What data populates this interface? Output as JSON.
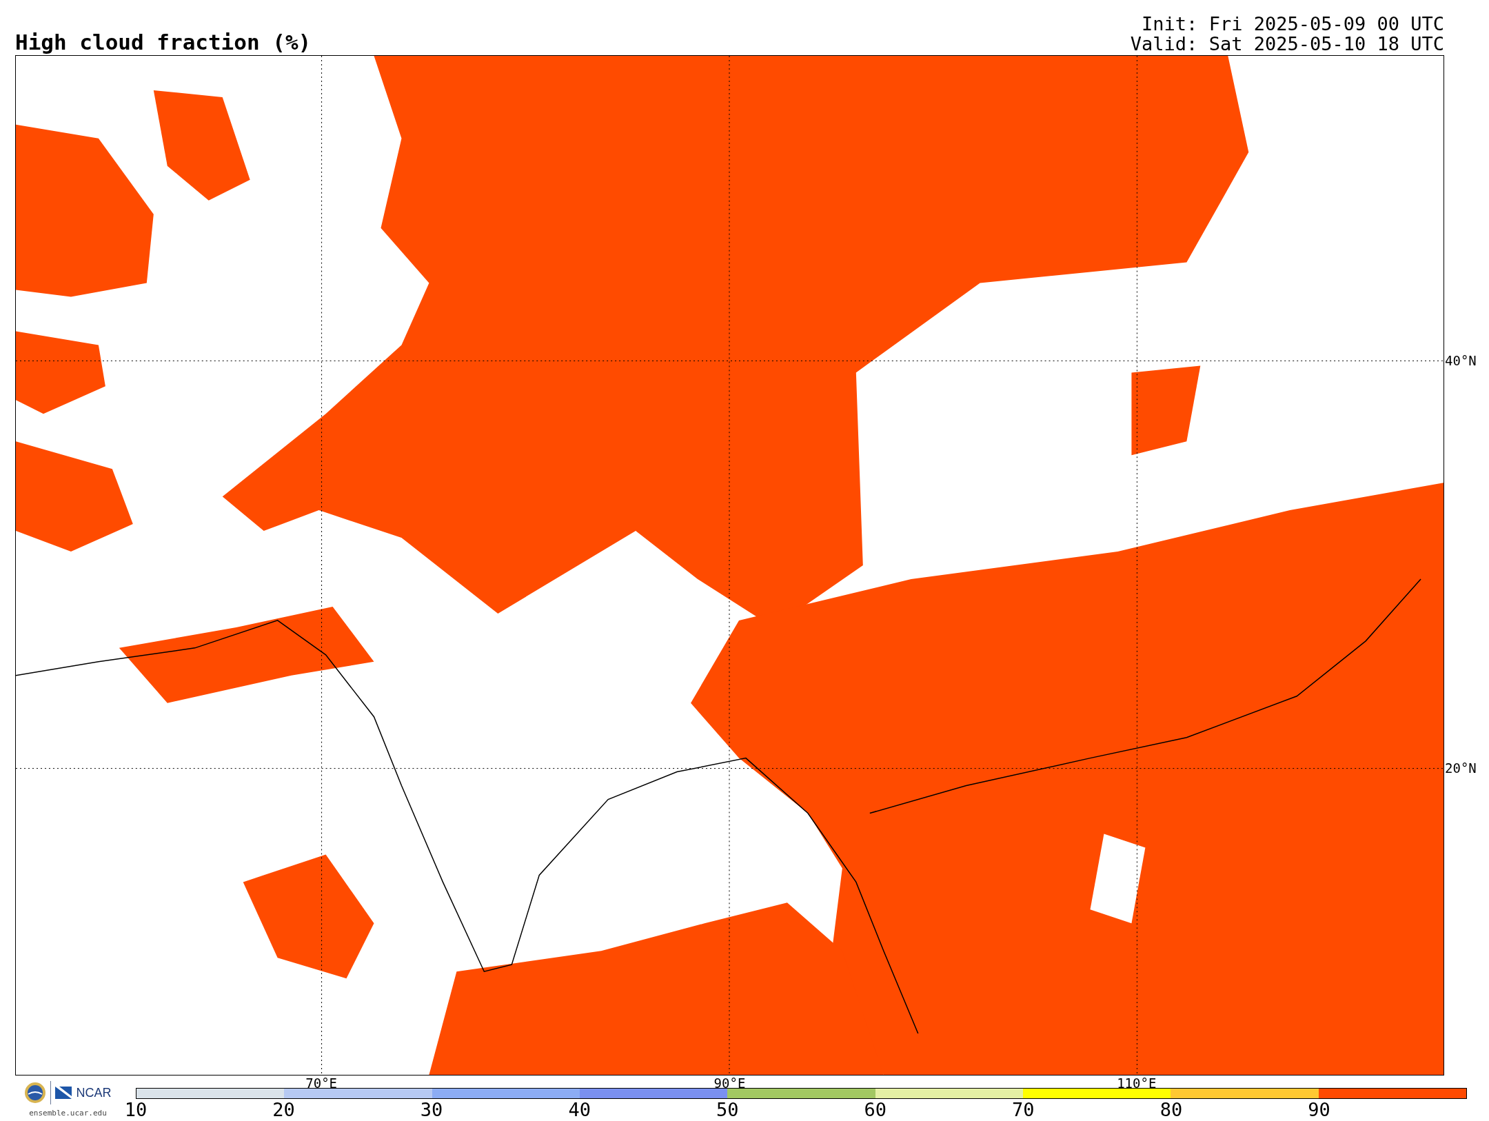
{
  "title": "High cloud fraction (%)",
  "init": "Init: Fri 2025-05-09 00 UTC",
  "valid": "Valid: Sat 2025-05-10 18 UTC",
  "map": {
    "latitudes": [
      {
        "label": "40°N"
      },
      {
        "label": "20°N"
      }
    ],
    "longitudes": [
      {
        "label": "70°E"
      },
      {
        "label": "90°E"
      },
      {
        "label": "110°E"
      }
    ]
  },
  "colorbar": {
    "bins": [
      {
        "label": "10",
        "color": "#dae3ea"
      },
      {
        "label": "20",
        "color": "#b6c9f2"
      },
      {
        "label": "30",
        "color": "#8cacf4"
      },
      {
        "label": "40",
        "color": "#7a90f0"
      },
      {
        "label": "50",
        "color": "#a2c862"
      },
      {
        "label": "60",
        "color": "#e4f0a4"
      },
      {
        "label": "70",
        "color": "#ffff00"
      },
      {
        "label": "80",
        "color": "#ffc832"
      },
      {
        "label": "90",
        "color": "#ff4a00"
      }
    ]
  },
  "logo": {
    "org": "NCAR",
    "site": "ensemble.ucar.edu"
  }
}
